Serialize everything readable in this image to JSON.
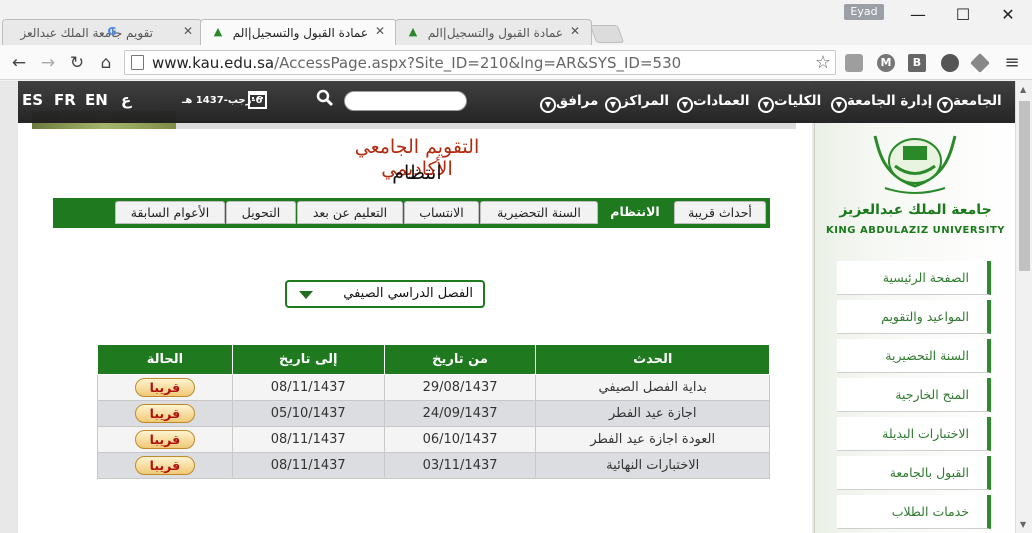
{
  "browser": {
    "tabs": [
      {
        "title": "تقويم جامعة الملك عبدالعز",
        "icon": "G"
      },
      {
        "title": "عمادة القبول والتسجيل|الم",
        "icon": "▲"
      },
      {
        "title": "عمادة القبول والتسجيل|الم",
        "icon": "▲"
      }
    ],
    "user": "Eyad",
    "url_host": "www.kau.edu.sa",
    "url_rest": "/AccessPage.aspx?Site_ID=210&lng=AR&SYS_ID=530"
  },
  "topnav": {
    "langs": [
      "ES",
      "FR",
      "EN",
      "ع"
    ],
    "hijri_date": "6-رجب-1437 هـ",
    "search_placeholder": "",
    "items": [
      "الجامعة",
      "إدارة الجامعة",
      "الكليات",
      "العمادات",
      "المراكز",
      "مرافق"
    ]
  },
  "sidebar": {
    "uni_name_ar": "جامعة الملك عبدالعزيز",
    "uni_name_en": "KING ABDULAZIZ UNIVERSITY",
    "items": [
      "الصفحة الرئيسية",
      "المواعيد والتقويم",
      "السنة التحضيرية",
      "المنح الخارجية",
      "الاختبارات البديلة",
      "القبول بالجامعة",
      "خدمات الطلاب"
    ]
  },
  "main": {
    "title": "التقويم الجامعي الأكاديمي",
    "subtitle": "انتظام",
    "tabs": [
      "أحداث قريبة",
      "الانتظام",
      "السنة التحضيرية",
      "الانتساب",
      "التعليم عن بعد",
      "التحويل",
      "الأعوام السابقة"
    ],
    "selected_term": "الفصل الدراسي الصيفي",
    "table": {
      "headers": [
        "الحدث",
        "من تاريخ",
        "إلى تاريخ",
        "الحالة"
      ],
      "rows": [
        [
          "بداية الفصل الصيفي",
          "29/08/1437",
          "08/11/1437",
          "قريبا"
        ],
        [
          "اجازة عيد الفطر",
          "24/09/1437",
          "05/10/1437",
          "قريبا"
        ],
        [
          "العودة اجازة عيد الفطر",
          "06/10/1437",
          "08/11/1437",
          "قريبا"
        ],
        [
          "الاختبارات النهائية",
          "03/11/1437",
          "08/11/1437",
          "قريبا"
        ]
      ]
    }
  },
  "colors": {
    "brand_green": "#1f7a1f",
    "title_red": "#b32a0e",
    "nav_dark": "#2a2a2a"
  }
}
